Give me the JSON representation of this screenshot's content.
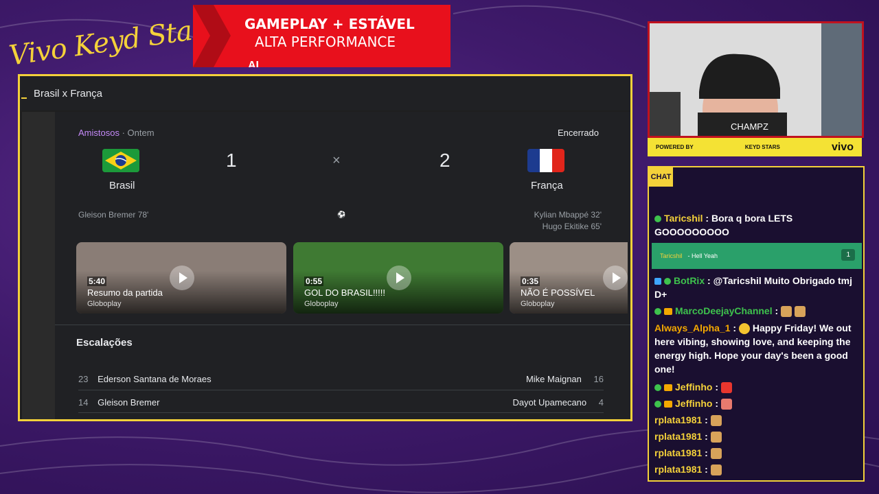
{
  "overlay": {
    "brand": "Vivo Keyd Stars",
    "promo": {
      "line1": "GAMEPLAY + ESTÁVEL",
      "line2": "ALTA PERFORMANCE",
      "line3": "AL"
    }
  },
  "match": {
    "title": "Brasil x França",
    "competition": "Amistosos",
    "when": "Ontem",
    "status": "Encerrado",
    "home": {
      "name": "Brasil",
      "score": "1",
      "scorers": [
        "Gleison Bremer 78'"
      ]
    },
    "away": {
      "name": "França",
      "score": "2",
      "scorers": [
        "Kylian Mbappé 32'",
        "Hugo Ekitike 65'"
      ]
    },
    "vs_symbol": "×",
    "ball_icon": "soccer-ball-icon"
  },
  "videos": [
    {
      "duration": "5:40",
      "title": "Resumo da partida",
      "source": "Globoplay",
      "color": "#8a7d76"
    },
    {
      "duration": "0:55",
      "title": "GOL DO BRASIL!!!!!",
      "source": "Globoplay",
      "color": "#3f7a33"
    },
    {
      "duration": "0:35",
      "title": "NÃO É POSSÍVEL",
      "source": "Globoplay",
      "color": "#9c8f86"
    }
  ],
  "lineups": {
    "title": "Escalações",
    "rows": [
      {
        "home_num": "23",
        "home_name": "Ederson Santana de Moraes",
        "away_name": "Mike Maignan",
        "away_num": "16"
      },
      {
        "home_num": "14",
        "home_name": "Gleison Bremer",
        "away_name": "Dayot Upamecano",
        "away_num": "4"
      }
    ]
  },
  "webcam": {
    "overlay_text": "CHAMPZ",
    "bar_powered": "POWERED BY",
    "bar_sponsor": "KEYD STARS",
    "bar_brand": "vivo"
  },
  "chat": {
    "tag": "CHAT",
    "messages": [
      {
        "user": "Taricshil",
        "text": "Bora q bora LETS GOOOOOOOOO"
      },
      {
        "user": "BotRix",
        "text": "@Taricshil Muito Obrigado tmj D+"
      },
      {
        "user": "MarcoDeejayChannel",
        "text": ""
      },
      {
        "user": "Always_Alpha_1",
        "text": "Happy Friday! We out here vibing, showing love, and keeping the energy high. Hope your day's been a good one!"
      },
      {
        "user": "Jeffinho",
        "text": ""
      },
      {
        "user": "Jeffinho",
        "text": ""
      },
      {
        "user": "rplata1981",
        "text": ""
      },
      {
        "user": "rplata1981",
        "text": ""
      },
      {
        "user": "rplata1981",
        "text": ""
      },
      {
        "user": "rplata1981",
        "text": ""
      }
    ],
    "redeem": {
      "user": "Taricshil",
      "text": "- Hell Yeah",
      "count": "1"
    }
  }
}
